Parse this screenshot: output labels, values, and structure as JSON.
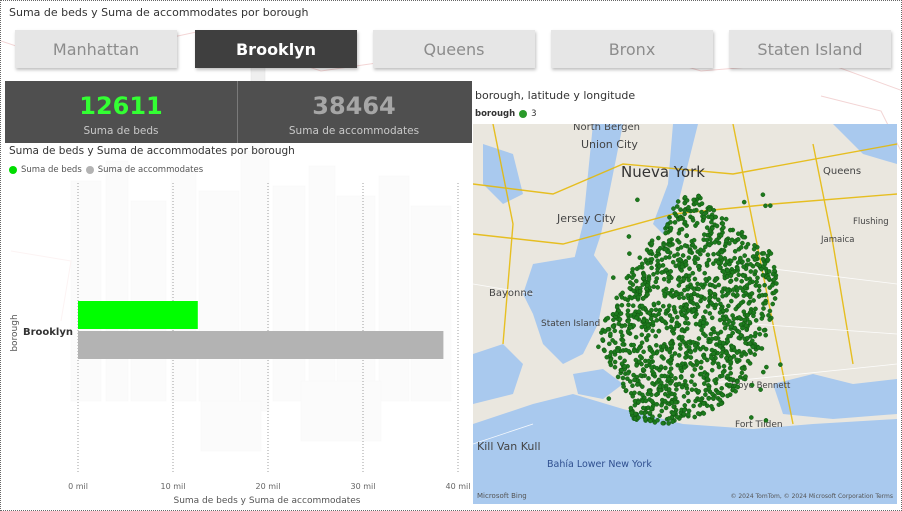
{
  "report_title": "Suma de beds y Suma de accommodates por borough",
  "tabs": [
    {
      "label": "Manhattan",
      "active": false
    },
    {
      "label": "Brooklyn",
      "active": true
    },
    {
      "label": "Queens",
      "active": false
    },
    {
      "label": "Bronx",
      "active": false
    },
    {
      "label": "Staten Island",
      "active": false
    }
  ],
  "kpis": [
    {
      "value": "12611",
      "label": "Suma de beds",
      "color": "#33ff33"
    },
    {
      "value": "38464",
      "label": "Suma de accommodates",
      "color": "#a6a6a6"
    }
  ],
  "bar_chart": {
    "title": "Suma de beds y Suma de accommodates por borough",
    "legend": [
      "Suma de beds",
      "Suma de accommodates"
    ]
  },
  "chart_data": {
    "type": "bar",
    "orientation": "horizontal",
    "categories": [
      "Brooklyn"
    ],
    "series": [
      {
        "name": "Suma de beds",
        "values": [
          12611
        ],
        "color": "#00ff00"
      },
      {
        "name": "Suma de accommodates",
        "values": [
          38464
        ],
        "color": "#b3b3b3"
      }
    ],
    "xlabel": "Suma de beds y Suma de accommodates",
    "ylabel": "borough",
    "xlim": [
      0,
      40000
    ],
    "xticks": [
      0,
      10000,
      20000,
      30000,
      40000
    ],
    "xtick_labels": [
      "0 mil",
      "10 mil",
      "20 mil",
      "30 mil",
      "40 mil"
    ],
    "grid": true,
    "legend_position": "top-left"
  },
  "map": {
    "title": "borough, latitude y longitude",
    "legend_label": "borough",
    "legend_item": "3",
    "dot_color": "#1d7a1d",
    "labels": [
      "North Bergen",
      "Union City",
      "Nueva York",
      "Jersey City",
      "Bayonne",
      "Staten Island",
      "Queens",
      "Flushing",
      "Jamaica",
      "Floyd Bennett",
      "Fort Tilden",
      "Bahía Lower New York",
      "Kill Van Kull"
    ],
    "attribution_left": "Microsoft Bing",
    "attribution_right": "© 2024 TomTom, © 2024 Microsoft Corporation  Terms"
  }
}
